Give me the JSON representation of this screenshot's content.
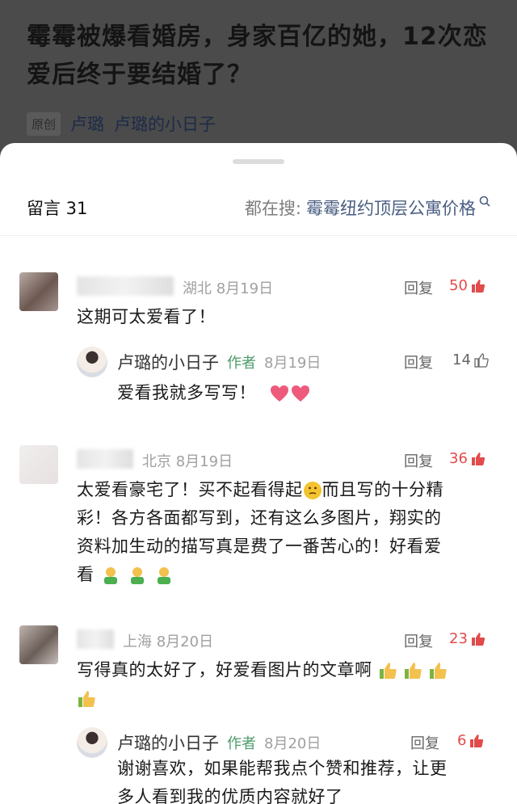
{
  "article": {
    "title": "霉霉被爆看婚房，身家百亿的她，12次恋爱后终于要结婚了？",
    "badge": "原创",
    "account": "卢璐",
    "column": "卢璐的小日子"
  },
  "sheet": {
    "comments_label": "留言 31",
    "search_prefix": "都在搜:",
    "search_query": "霉霉纽约顶层公寓价格"
  },
  "comments": [
    {
      "location_date": "湖北 8月19日",
      "reply": "回复",
      "likes": "50",
      "text": "这期可太爱看了！"
    },
    {
      "author": "卢璐的小日子",
      "author_tag": "作者",
      "date": "8月19日",
      "reply": "回复",
      "likes": "14",
      "text": "爱看我就多写写！"
    },
    {
      "location_date": "北京 8月19日",
      "reply": "回复",
      "likes": "36",
      "text_lines": [
        "太爱看豪宅了！买不起看得起",
        "而且写的十分精",
        "彩！各方各面都写到，还有这么多图片，翔实的",
        "资料加生动的描写真是费了一番苦心的！好看爱",
        "看"
      ]
    },
    {
      "location_date": "上海 8月20日",
      "reply": "回复",
      "likes": "23",
      "text": "写得真的太好了，好爱看图片的文章啊"
    },
    {
      "author": "卢璐的小日子",
      "author_tag": "作者",
      "date": "8月20日",
      "reply": "回复",
      "likes": "6",
      "text_lines": [
        "谢谢喜欢，如果能帮我点个赞和推荐，让更",
        "多人看到我的优质内容就好了"
      ]
    }
  ],
  "colors": {
    "accent_red": "#e14b4b",
    "author_green": "#4c9b6a",
    "link_blue": "#4a5e82"
  }
}
